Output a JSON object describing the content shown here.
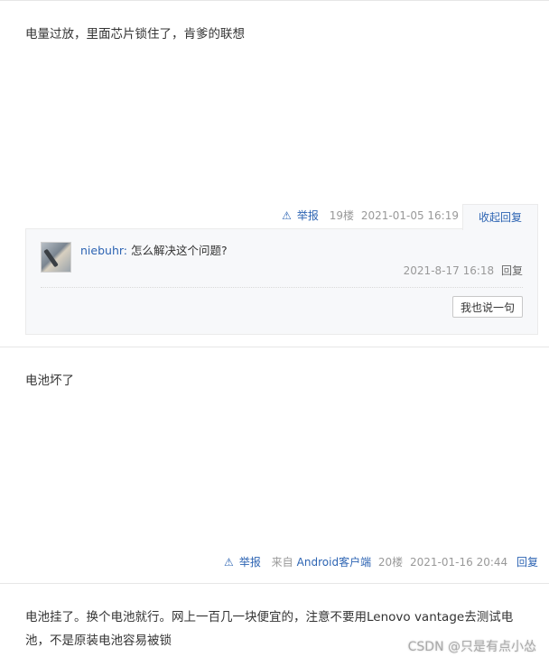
{
  "posts": [
    {
      "content": "电量过放，里面芯片锁住了，肯爹的联想",
      "report_label": "举报",
      "floor": "19楼",
      "time": "2021-01-05 16:19",
      "collapse_label": "收起回复",
      "comments": [
        {
          "user": "niebuhr:",
          "text": "怎么解决这个问题?",
          "time": "2021-8-17 16:18",
          "reply_label": "回复"
        }
      ],
      "say_button": "我也说一句"
    },
    {
      "content": "电池坏了",
      "report_label": "举报",
      "source_prefix": "来自",
      "source_link": "Android客户端",
      "floor": "20楼",
      "time": "2021-01-16 20:44",
      "reply_label": "回复"
    },
    {
      "content": "电池挂了。换个电池就行。网上一百几一块便宜的，注意不要用Lenovo vantage去测试电池，不是原装电池容易被锁"
    }
  ],
  "watermark": "CSDN @只是有点小怂",
  "icons": {
    "report": "warning-triangle-icon",
    "avatar": "user-avatar"
  },
  "colors": {
    "link": "#2d64b3",
    "muted": "#999999",
    "panel_bg": "#f7f8fa"
  }
}
